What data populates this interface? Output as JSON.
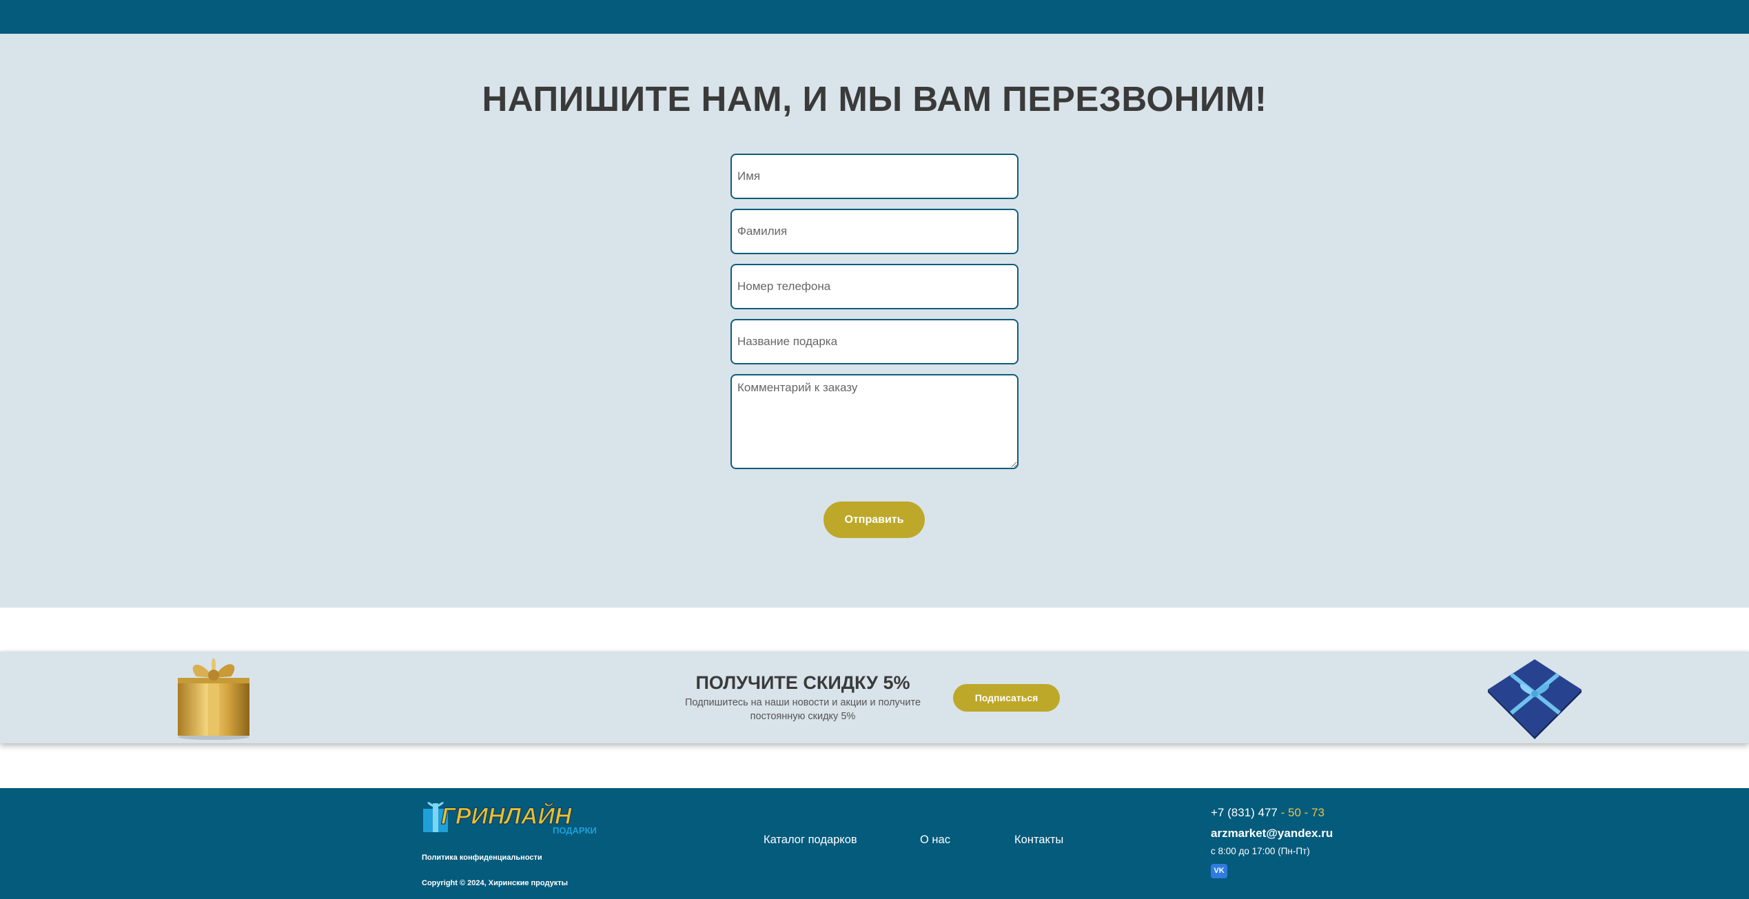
{
  "contact_form": {
    "title": "НАПИШИТЕ НАМ, И МЫ ВАМ ПЕРЕЗВОНИМ!",
    "fields": {
      "first_name_placeholder": "Имя",
      "last_name_placeholder": "Фамилия",
      "phone_placeholder": "Номер телефона",
      "gift_name_placeholder": "Название подарка",
      "comment_placeholder": "Комментарий к заказу"
    },
    "submit_label": "Отправить"
  },
  "promo": {
    "title": "ПОЛУЧИТЕ СКИДКУ 5%",
    "subtitle": "Подпишитесь на наши новости и акции и получите постоянную скидку 5%",
    "subscribe_label": "Подписаться"
  },
  "footer": {
    "logo_text": "ГРИНЛАЙН",
    "logo_subtext": "ПОДАРКИ",
    "privacy_link": "Политика конфиденциальности",
    "copyright": "Copyright © 2024, Хиринские продукты",
    "nav": {
      "catalog": "Каталог подарков",
      "about": "О нас",
      "contacts": "Контакты"
    },
    "phone_main": "+7 (831) 477",
    "phone_sep": " - ",
    "phone_accent": "50 - 73",
    "email": "arzmarket@yandex.ru",
    "hours": "с 8:00 до 17:00 (Пн-Пт)",
    "social_vk": "VK"
  },
  "colors": {
    "brand_blue": "#045b7c",
    "section_bg": "#d9e3ea",
    "accent_gold": "#bda82a",
    "phone_accent": "#e9c44a"
  }
}
